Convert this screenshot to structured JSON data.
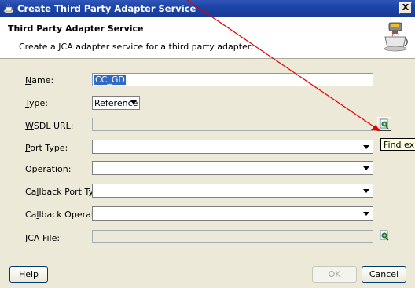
{
  "window": {
    "title": "Create Third Party Adapter Service",
    "close_glyph": "X"
  },
  "header": {
    "title": "Third Party Adapter Service",
    "subtitle": "Create a JCA adapter service for a third party adapter."
  },
  "fields": {
    "name": {
      "label": "Name:",
      "mnemonic": "N",
      "rest": "ame:",
      "value": "CC_GD"
    },
    "type": {
      "label": "Type:",
      "mnemonic": "T",
      "rest": "ype:",
      "value": "Reference"
    },
    "wsdl_url": {
      "label": "WSDL URL:",
      "mnemonic": "W",
      "rest": "SDL URL:",
      "value": ""
    },
    "port_type": {
      "label": "Port Type:",
      "mnemonic": "P",
      "rest": "ort Type:",
      "value": ""
    },
    "operation": {
      "label": "Operation:",
      "mnemonic": "O",
      "rest": "peration:",
      "value": ""
    },
    "callback_port_type": {
      "label": "Callback Port Type:",
      "pre": "Ca",
      "mnemonic": "l",
      "rest": "lback Port Type:",
      "value": ""
    },
    "callback_operation": {
      "label": "Callback Operation:",
      "pre": "Ca",
      "mnemonic": "l",
      "rest": "lback Operation:",
      "value": ""
    },
    "jca_file": {
      "label": "JCA File:",
      "mnemonic": "J",
      "rest": "CA File:",
      "value": ""
    }
  },
  "tooltip": {
    "text": "Find exist"
  },
  "buttons": {
    "help": "Help",
    "ok": "OK",
    "cancel": "Cancel"
  },
  "colors": {
    "title_bar": "#1d45a8",
    "selection": "#316ac5",
    "annotation_arrow": "#e00000",
    "dialog_bg": "#ece9d8"
  },
  "icons": {
    "app": "coffee-cup-icon",
    "wizard": "adapter-wizard-icon",
    "find": "find-existing-wsdl-icon"
  }
}
